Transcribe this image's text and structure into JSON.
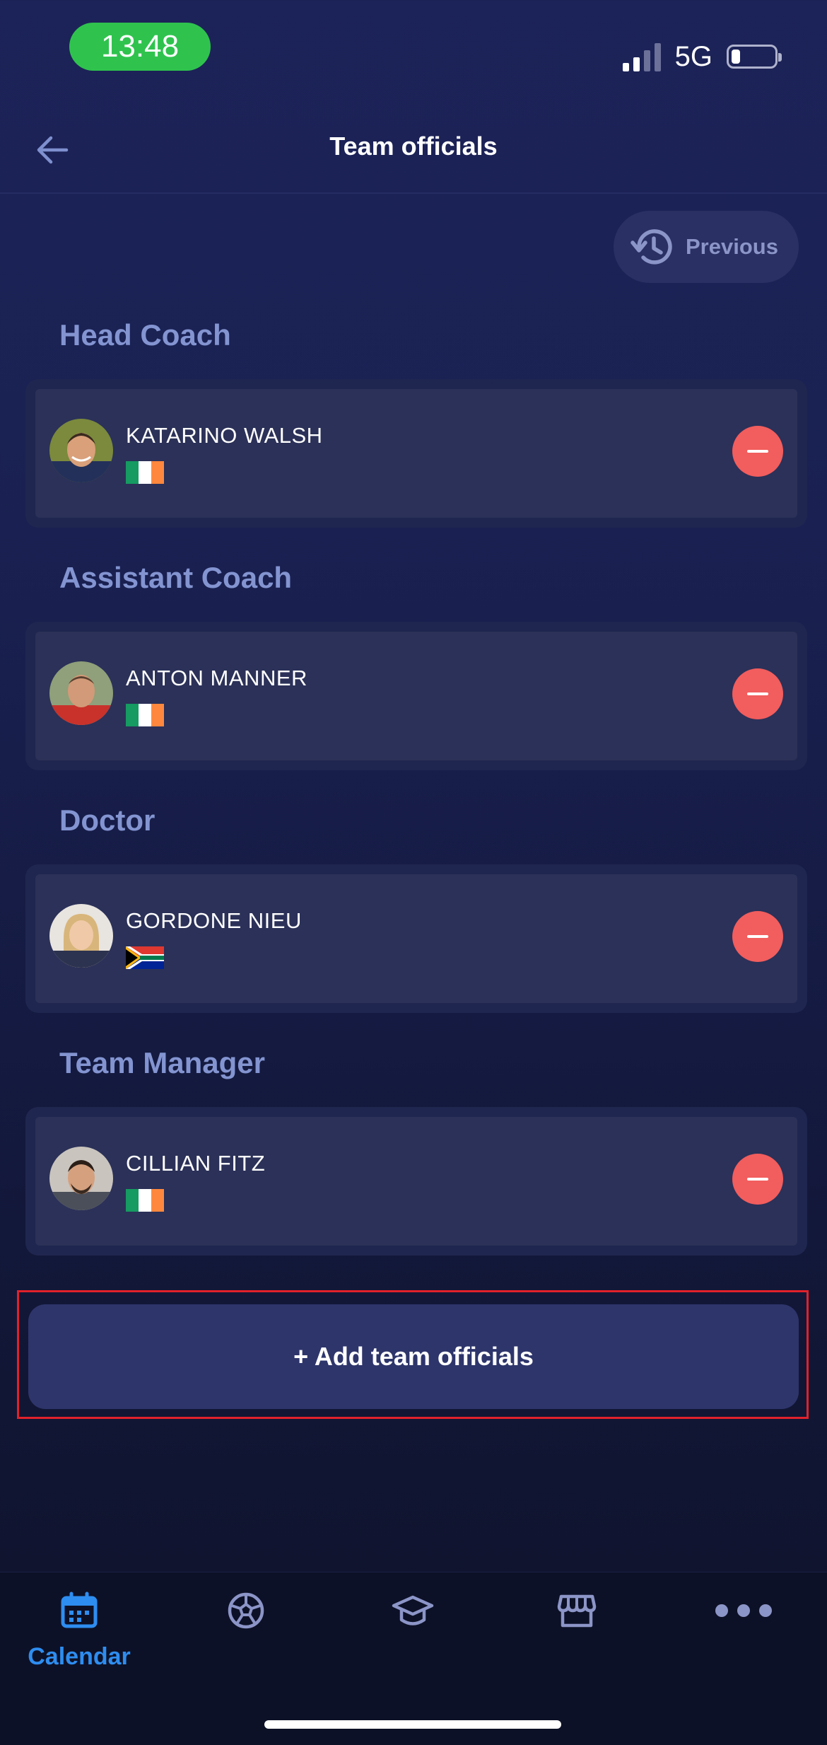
{
  "status_bar": {
    "time": "13:48",
    "network": "5G"
  },
  "header": {
    "title": "Team officials"
  },
  "previous_button": {
    "label": "Previous"
  },
  "sections": [
    {
      "title": "Head Coach",
      "person": {
        "name": "KATARINO WALSH",
        "flag": "ireland"
      }
    },
    {
      "title": "Assistant Coach",
      "person": {
        "name": "ANTON MANNER",
        "flag": "ireland"
      }
    },
    {
      "title": "Doctor",
      "person": {
        "name": "GORDONE NIEU",
        "flag": "south-africa"
      }
    },
    {
      "title": "Team Manager",
      "person": {
        "name": "CILLIAN FITZ",
        "flag": "ireland"
      }
    }
  ],
  "add_button": {
    "label": "+ Add team officials"
  },
  "bottom_nav": {
    "items": [
      {
        "icon": "calendar-icon",
        "label": "Calendar",
        "active": true
      },
      {
        "icon": "soccer-ball-icon"
      },
      {
        "icon": "graduation-cap-icon"
      },
      {
        "icon": "store-icon"
      },
      {
        "icon": "more-icon"
      }
    ]
  },
  "colors": {
    "accent": "#2e8df0",
    "remove": "#f25d5d",
    "section_title": "#8394d1",
    "highlight": "#e0212b"
  }
}
